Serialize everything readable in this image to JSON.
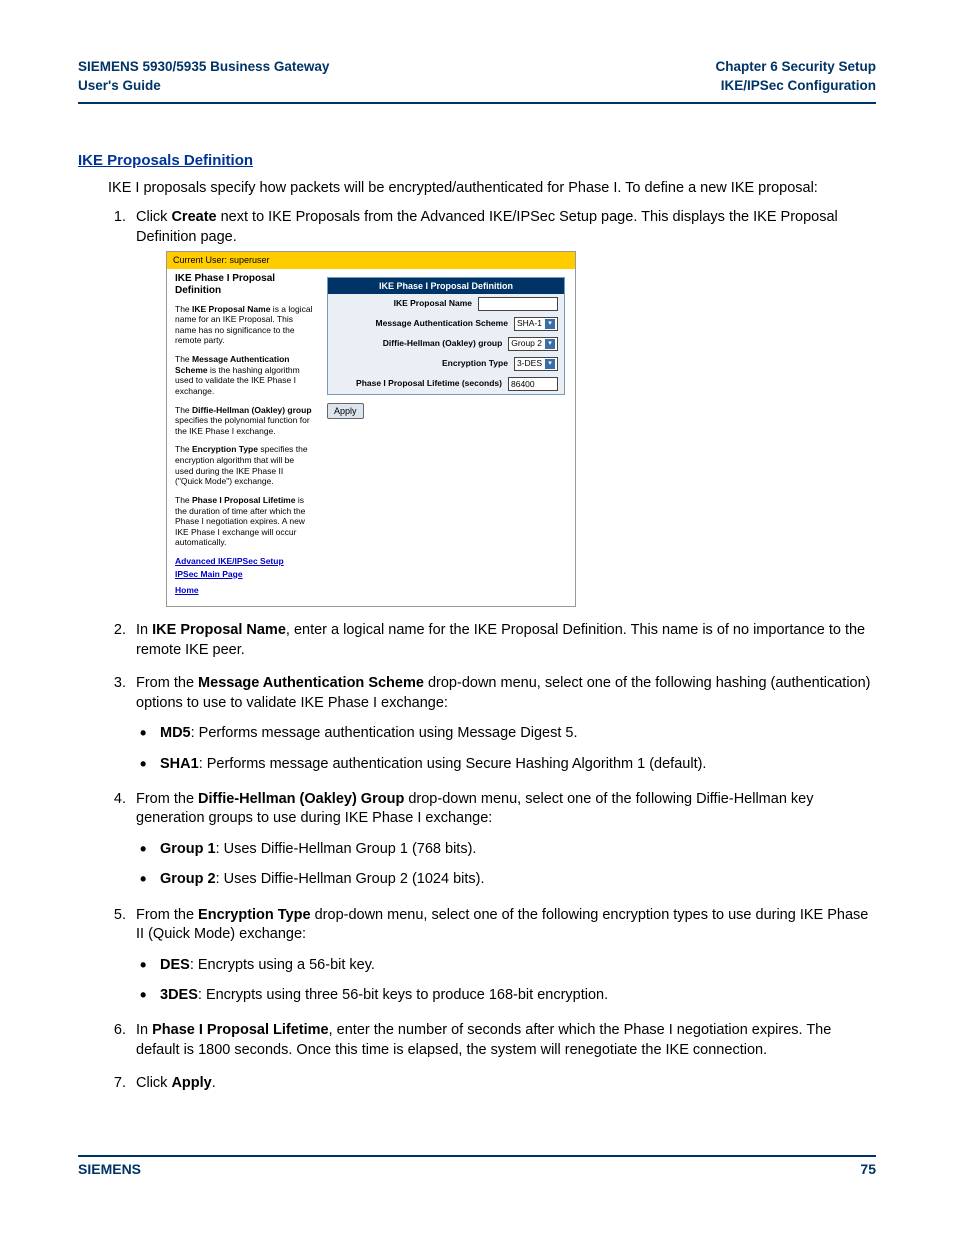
{
  "header": {
    "left_line1": "SIEMENS 5930/5935 Business Gateway",
    "left_line2": "User's Guide",
    "right_line1": "Chapter 6  Security Setup",
    "right_line2": "IKE/IPSec Configuration"
  },
  "section_heading": "IKE Proposals Definition",
  "intro": "IKE I proposals specify how packets will be encrypted/authenticated for Phase I. To define a new IKE proposal:",
  "step1": {
    "pre": "Click ",
    "bold": "Create",
    "post": " next to IKE Proposals from the Advanced IKE/IPSec Setup page. This displays the IKE Proposal Definition page."
  },
  "screenshot": {
    "userbar": "Current User: superuser",
    "left_title": "IKE Phase I Proposal Definition",
    "p1": {
      "pre": "The ",
      "b": "IKE Proposal Name",
      "post": " is a logical name for an IKE Proposal. This name has no significance to the remote party."
    },
    "p2": {
      "pre": "The ",
      "b": "Message Authentication Scheme",
      "post": " is the hashing algorithm used to validate the IKE Phase I exchange."
    },
    "p3": {
      "pre": "The ",
      "b": "Diffie-Hellman (Oakley) group",
      "post": " specifies the polynomial function for the IKE Phase I exchange."
    },
    "p4": {
      "pre": "The ",
      "b": "Encryption Type",
      "post": " specifies the encryption algorithm that will be used during the IKE Phase II (\"Quick Mode\") exchange."
    },
    "p5": {
      "pre": "The ",
      "b": "Phase I Proposal Lifetime",
      "post": " is the duration of time after which the Phase I negotiation expires. A new IKE Phase I exchange will occur automatically."
    },
    "links": {
      "adv": "Advanced IKE/IPSec Setup",
      "main": "IPSec Main Page",
      "home": "Home"
    },
    "panel_title": "IKE Phase I Proposal Definition",
    "rows": {
      "name": {
        "label": "IKE Proposal Name",
        "value": ""
      },
      "mas": {
        "label": "Message Authentication Scheme",
        "value": "SHA-1"
      },
      "dh": {
        "label": "Diffie-Hellman (Oakley) group",
        "value": "Group 2"
      },
      "enc": {
        "label": "Encryption Type",
        "value": "3-DES"
      },
      "life": {
        "label": "Phase I Proposal Lifetime (seconds)",
        "value": "86400"
      }
    },
    "apply": "Apply"
  },
  "step2": {
    "pre": "In ",
    "bold": "IKE Proposal Name",
    "post": ", enter a logical name for the IKE Proposal Definition. This name is of no importance to the remote IKE peer."
  },
  "step3": {
    "pre": "From the ",
    "bold": "Message Authentication Scheme",
    "post": " drop-down menu, select one of the following hashing (authentication) options to use to validate IKE Phase I exchange:",
    "bullets": [
      {
        "b": "MD5",
        "t": ": Performs message authentication using Message Digest 5."
      },
      {
        "b": "SHA1",
        "t": ": Performs message authentication using Secure Hashing Algorithm 1 (default)."
      }
    ]
  },
  "step4": {
    "pre": "From the ",
    "bold": "Diffie-Hellman (Oakley) Group",
    "post": " drop-down menu, select one of the following Diffie-Hellman key generation groups to use during IKE Phase I exchange:",
    "bullets": [
      {
        "b": "Group 1",
        "t": ": Uses Diffie-Hellman Group 1 (768 bits)."
      },
      {
        "b": "Group 2",
        "t": ": Uses Diffie-Hellman Group 2 (1024 bits)."
      }
    ]
  },
  "step5": {
    "pre": "From the ",
    "bold": "Encryption Type",
    "post": " drop-down menu, select one of the following encryption types to use during IKE Phase II (Quick Mode) exchange:",
    "bullets": [
      {
        "b": "DES",
        "t": ": Encrypts using a 56-bit key."
      },
      {
        "b": "3DES",
        "t": ": Encrypts using three 56-bit keys to produce 168-bit encryption."
      }
    ]
  },
  "step6": {
    "pre": "In ",
    "bold": "Phase I Proposal Lifetime",
    "post": ", enter the number of seconds after which the Phase I negotiation expires. The default is 1800 seconds. Once this time is elapsed, the system will renegotiate the IKE connection."
  },
  "step7": {
    "pre": "Click ",
    "bold": "Apply",
    "post": "."
  },
  "footer": {
    "left": "SIEMENS",
    "right": "75"
  }
}
